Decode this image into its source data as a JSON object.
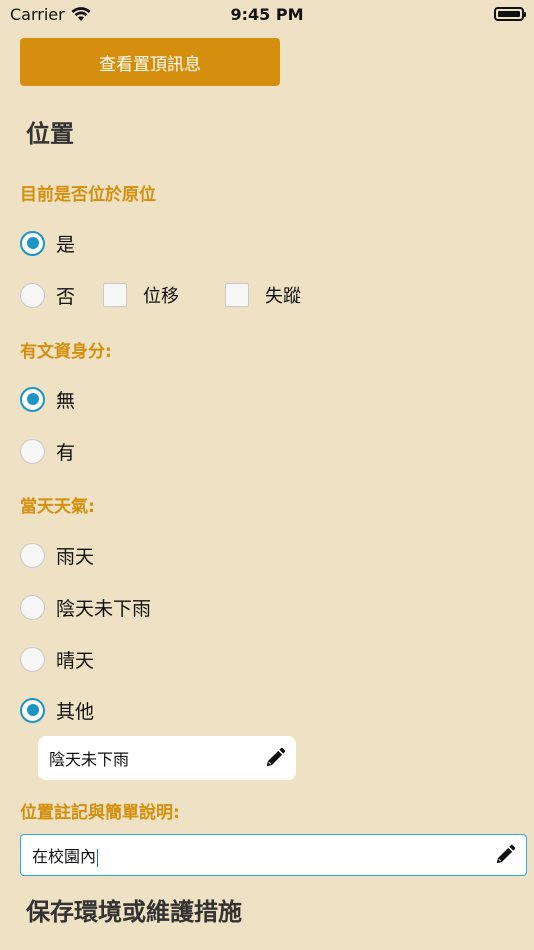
{
  "status_bar": {
    "carrier": "Carrier",
    "time": "9:45 PM"
  },
  "top_button": {
    "label": "查看置頂訊息"
  },
  "location": {
    "title": "位置",
    "in_place": {
      "label": "目前是否位於原位",
      "options": [
        {
          "label": "是",
          "selected": true
        },
        {
          "label": "否",
          "selected": false
        }
      ],
      "checkboxes": [
        {
          "label": "位移",
          "checked": false
        },
        {
          "label": "失蹤",
          "checked": false
        }
      ]
    },
    "cultural_status": {
      "label": "有文資身分:",
      "options": [
        {
          "label": "無",
          "selected": true
        },
        {
          "label": "有",
          "selected": false
        }
      ]
    },
    "weather": {
      "label": "當天天氣:",
      "options": [
        {
          "label": "雨天",
          "selected": false
        },
        {
          "label": "陰天未下雨",
          "selected": false
        },
        {
          "label": "晴天",
          "selected": false
        },
        {
          "label": "其他",
          "selected": true
        }
      ],
      "other_value": "陰天未下雨"
    },
    "notes": {
      "label": "位置註記與簡單說明:",
      "value": "在校園內"
    }
  },
  "preservation": {
    "title": "保存環境或維護措施"
  },
  "colors": {
    "accent": "#d48f0e",
    "radio_selected": "#1a95c6",
    "background": "#efe1c3"
  }
}
